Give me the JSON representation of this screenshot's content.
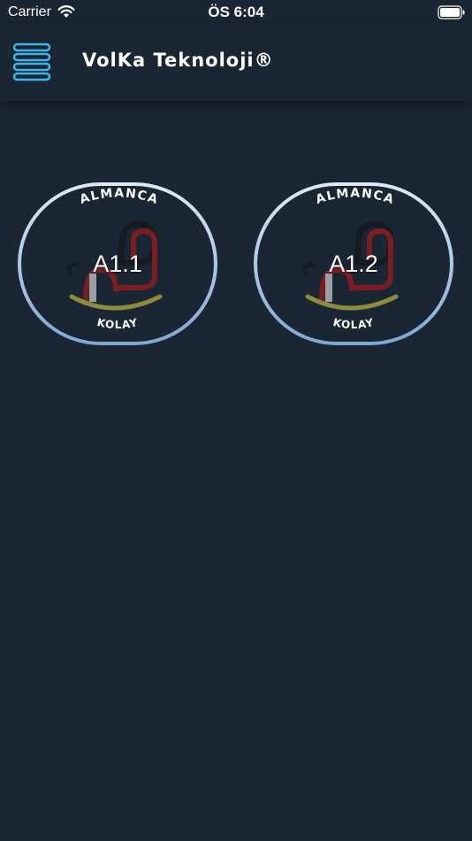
{
  "status_bar": {
    "carrier": "Carrier",
    "time": "ÖS 6:04",
    "wifi_icon": "wifi-icon",
    "battery_icon": "battery-icon"
  },
  "header": {
    "menu_icon": "stacked-pills-menu-icon",
    "title": "VolKa Teknoloji®"
  },
  "levels": [
    {
      "label": "A1.1",
      "arc_top": "ALMANCA",
      "arc_bottom": "KOLAY",
      "logo_icon": "rocking-horse-icon"
    },
    {
      "label": "A1.2",
      "arc_top": "ALMANCA",
      "arc_bottom": "KOLAY",
      "logo_icon": "rocking-horse-icon"
    }
  ],
  "colors": {
    "background": "#1b2634",
    "menu_icon": "#3fb3e8",
    "card_border": "#b8d2ee",
    "horse_red": "#7a1e22",
    "horse_dark": "#161b22",
    "rocker_olive": "#8b8d3a"
  }
}
